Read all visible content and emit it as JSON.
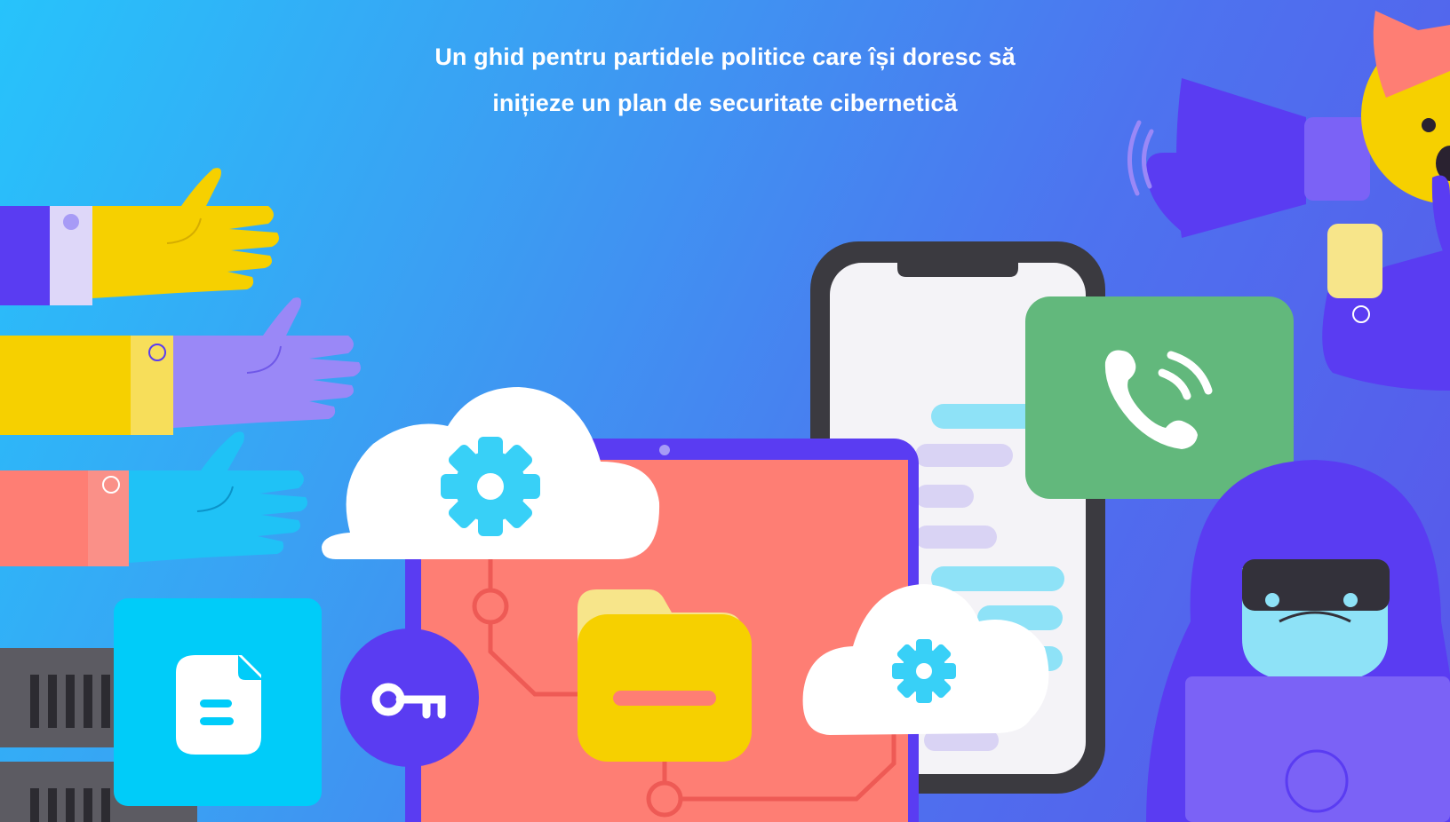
{
  "hero": {
    "headline_line1": "Un ghid pentru partidele politice care își doresc să",
    "headline_line2": "inițieze un plan de securitate cibernetică"
  },
  "colors": {
    "background_start": "#27c3fb",
    "background_end": "#5956ea",
    "tablet": "#fe7e74",
    "call_card": "#62b87c",
    "folder": "#f6d000",
    "document_card": "#00ccf9",
    "key_circle": "#5a3cf2",
    "hacker": "#5a3cf2"
  },
  "illustration": {
    "icons": [
      "hand-yellow-icon",
      "hand-purple-icon",
      "hand-cyan-icon",
      "megaphone-icon",
      "phone-icon",
      "phone-call-icon",
      "cloud-gear-icon",
      "tablet-icon",
      "folder-icon",
      "key-icon",
      "document-icon",
      "server-rack-icon",
      "hacker-icon",
      "cat-icon"
    ]
  }
}
